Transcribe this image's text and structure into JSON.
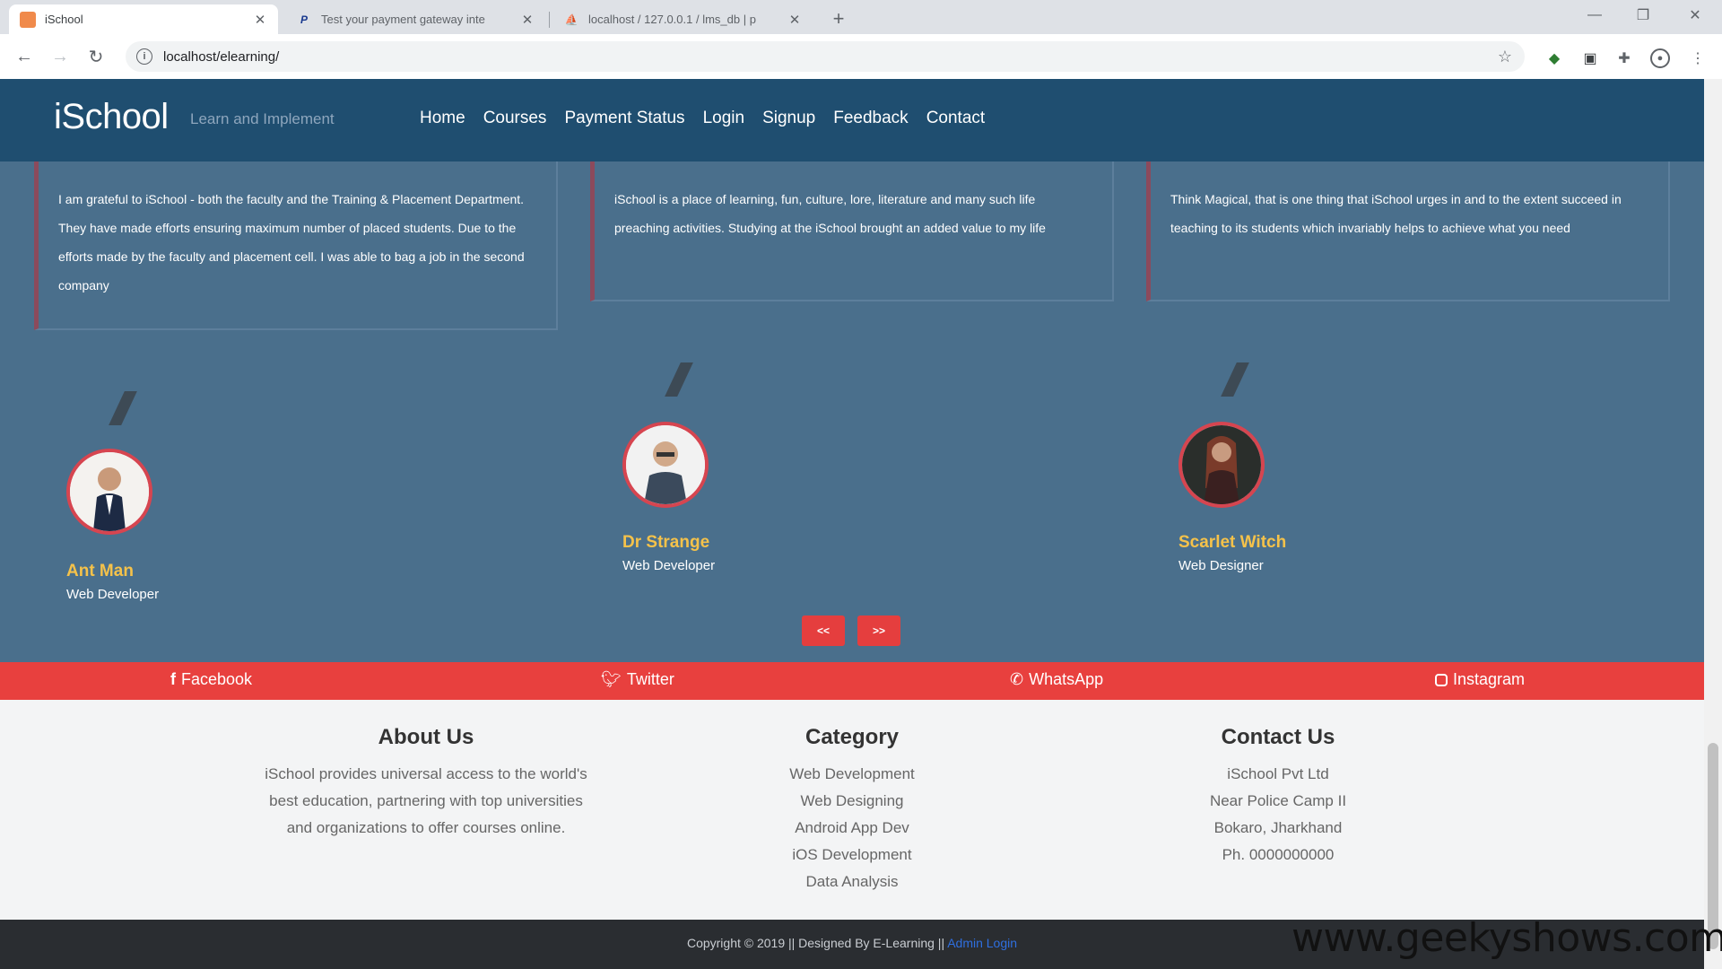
{
  "browser": {
    "tabs": [
      {
        "title": "iSchool",
        "icon": "orange-square-icon",
        "active": true
      },
      {
        "title": "Test your payment gateway inte",
        "icon": "paytm-icon",
        "active": false
      },
      {
        "title": "localhost / 127.0.0.1 / lms_db | p",
        "icon": "phpmyadmin-icon",
        "active": false
      }
    ],
    "url": "localhost/elearning/"
  },
  "site": {
    "brand": "iSchool",
    "tagline": "Learn and Implement",
    "menu": [
      "Home",
      "Courses",
      "Payment Status",
      "Login",
      "Signup",
      "Feedback",
      "Contact"
    ]
  },
  "testimonials": [
    {
      "quote": "I am grateful to iSchool - both the faculty and the Training & Placement Department. They have made efforts ensuring maximum number of placed students. Due to the efforts made by the faculty and placement cell. I was able to bag a job in the second company",
      "name": "Ant Man",
      "role": "Web Developer"
    },
    {
      "quote": "iSchool is a place of learning, fun, culture, lore, literature and many such life preaching activities. Studying at the iSchool brought an added value to my life",
      "name": "Dr Strange",
      "role": "Web Developer"
    },
    {
      "quote": "Think Magical, that is one thing that iSchool urges in and to the extent succeed in teaching to its students which invariably helps to achieve what you need",
      "name": "Scarlet Witch",
      "role": "Web Designer"
    }
  ],
  "carousel": {
    "prev": "<<",
    "next": ">>"
  },
  "social": [
    "Facebook",
    "Twitter",
    "WhatsApp",
    "Instagram"
  ],
  "footer": {
    "about": {
      "title": "About Us",
      "lines": [
        "iSchool provides universal access to the world's",
        "best education, partnering with top universities",
        "and organizations to offer courses online."
      ]
    },
    "category": {
      "title": "Category",
      "lines": [
        "Web Development",
        "Web Designing",
        "Android App Dev",
        "iOS Development",
        "Data Analysis"
      ]
    },
    "contact": {
      "title": "Contact Us",
      "lines": [
        "iSchool Pvt Ltd",
        "Near Police Camp II",
        "Bokaro, Jharkhand",
        "Ph. 0000000000"
      ]
    }
  },
  "copyright": {
    "text": "Copyright © 2019 || Designed By E-Learning || ",
    "admin": "Admin Login"
  },
  "watermark": "www.geekyshows.com",
  "colors": {
    "nav": "#1f4e70",
    "section": "#4a6f8c",
    "accent": "#e8403e",
    "name": "#f5c24a"
  }
}
